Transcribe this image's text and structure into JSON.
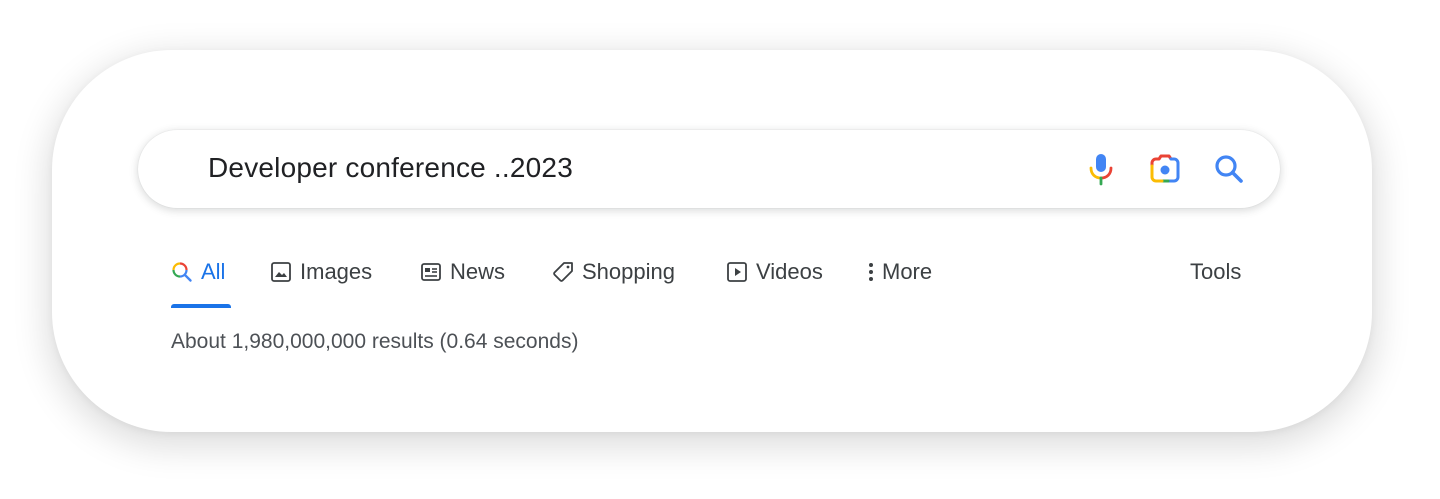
{
  "search": {
    "query": "Developer conference ..2023",
    "icons": [
      "mic-icon",
      "lens-icon",
      "search-icon"
    ]
  },
  "tabs": [
    {
      "label": "All",
      "icon": "search-icon",
      "active": true
    },
    {
      "label": "Images",
      "icon": "image-icon",
      "active": false
    },
    {
      "label": "News",
      "icon": "newspaper-icon",
      "active": false
    },
    {
      "label": "Shopping",
      "icon": "tag-icon",
      "active": false
    },
    {
      "label": "Videos",
      "icon": "play-icon",
      "active": false
    },
    {
      "label": "More",
      "icon": "more-vert-icon",
      "active": false
    }
  ],
  "tools_label": "Tools",
  "result_stats": "About 1,980,000,000 results (0.64 seconds)",
  "colors": {
    "accent": "#1a73e8",
    "text": "#202124",
    "tab_text": "#3c4043",
    "stats_text": "#4d5156",
    "google_red": "#ea4335",
    "google_yellow": "#fbbc04",
    "google_green": "#34a853",
    "google_blue": "#4285f4"
  }
}
